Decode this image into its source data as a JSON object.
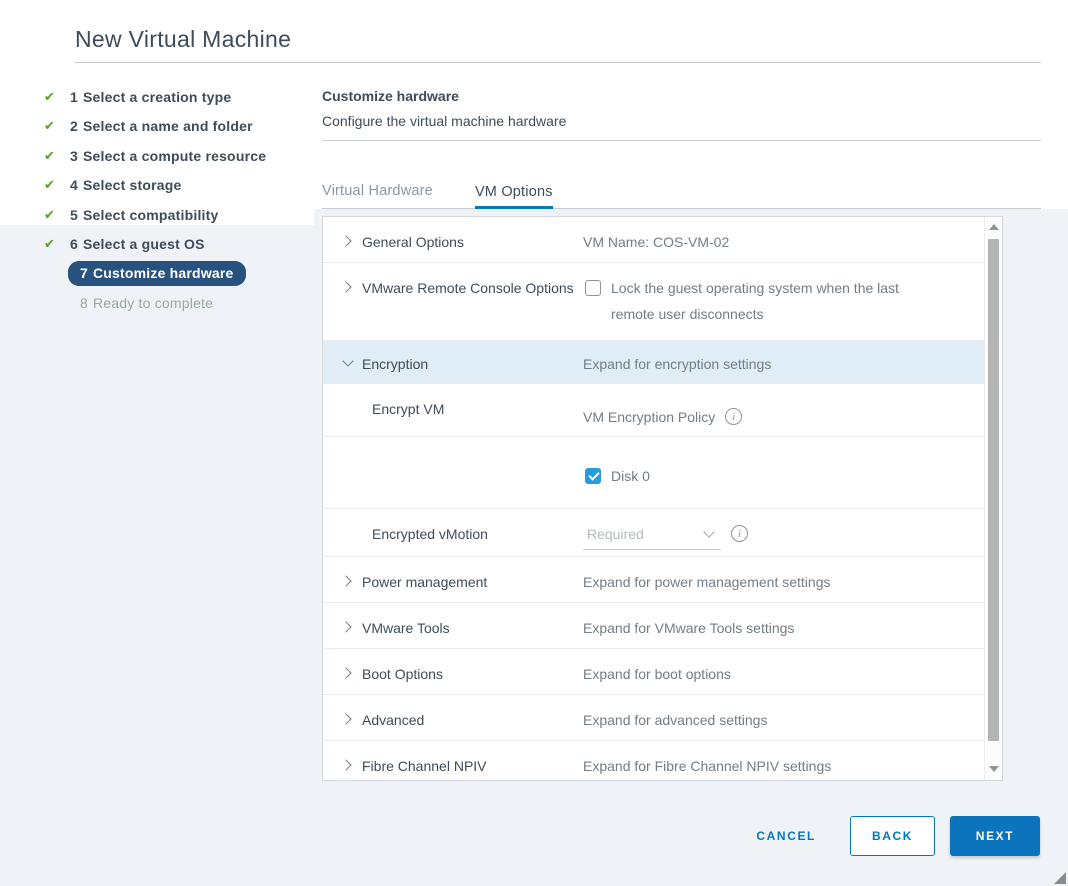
{
  "colors": {
    "accent_blue": "#0079b8",
    "next_button_blue": "#0b74bd",
    "checkbox_blue": "#279bdb",
    "step_badge_navy": "#28527d",
    "check_green": "#55a121",
    "row_highlight": "#e0ecf6",
    "page_tint": "#eff3f8"
  },
  "window": {
    "title": "New Virtual Machine"
  },
  "steps": [
    {
      "num": "1",
      "label": "Select a creation type",
      "state": "done"
    },
    {
      "num": "2",
      "label": "Select a name and folder",
      "state": "done"
    },
    {
      "num": "3",
      "label": "Select a compute resource",
      "state": "done"
    },
    {
      "num": "4",
      "label": "Select storage",
      "state": "done"
    },
    {
      "num": "5",
      "label": "Select compatibility",
      "state": "done"
    },
    {
      "num": "6",
      "label": "Select a guest OS",
      "state": "done"
    },
    {
      "num": "7",
      "label": "Customize hardware",
      "state": "current"
    },
    {
      "num": "8",
      "label": "Ready to complete",
      "state": "upcoming"
    }
  ],
  "pane": {
    "title": "Customize hardware",
    "subtitle": "Configure the virtual machine hardware"
  },
  "tabs": [
    {
      "label": "Virtual Hardware",
      "active": false
    },
    {
      "label": "VM Options",
      "active": true
    }
  ],
  "options_table": {
    "rows": [
      {
        "id": "general-options",
        "chevron": "collapsed",
        "label": "General Options",
        "right": {
          "type": "text",
          "text": "VM Name: COS-VM-02"
        }
      },
      {
        "id": "vmrc-options",
        "chevron": "collapsed",
        "label": "VMware Remote Console Options",
        "right": {
          "type": "checkbox",
          "checked": false,
          "text": "Lock the guest operating system when the last remote user disconnects"
        }
      },
      {
        "id": "encryption",
        "chevron": "expanded",
        "label": "Encryption",
        "highlighted": true,
        "right": {
          "type": "text",
          "text": "Expand for encryption settings"
        }
      },
      {
        "id": "encrypt-vm",
        "chevron": null,
        "indent": true,
        "label": "Encrypt VM",
        "right": {
          "type": "text-info",
          "text": "VM Encryption Policy"
        }
      },
      {
        "id": "disk-0",
        "chevron": null,
        "label": "",
        "right": {
          "type": "checkbox",
          "checked": true,
          "text": "Disk 0"
        }
      },
      {
        "id": "encrypted-vmotion",
        "chevron": null,
        "indent": true,
        "label": "Encrypted vMotion",
        "right": {
          "type": "select",
          "value": "Required",
          "disabled": true,
          "info": true
        }
      },
      {
        "id": "power-management",
        "chevron": "collapsed",
        "label": "Power management",
        "right": {
          "type": "text",
          "text": "Expand for power management settings"
        }
      },
      {
        "id": "vmware-tools",
        "chevron": "collapsed",
        "label": "VMware Tools",
        "right": {
          "type": "text",
          "text": "Expand for VMware Tools settings"
        }
      },
      {
        "id": "boot-options",
        "chevron": "collapsed",
        "label": "Boot Options",
        "right": {
          "type": "text",
          "text": "Expand for boot options"
        }
      },
      {
        "id": "advanced",
        "chevron": "collapsed",
        "label": "Advanced",
        "right": {
          "type": "text",
          "text": "Expand for advanced settings"
        }
      },
      {
        "id": "fibre-channel-npiv",
        "chevron": "collapsed",
        "label": "Fibre Channel NPIV",
        "right": {
          "type": "text",
          "text": "Expand for Fibre Channel NPIV settings"
        }
      }
    ]
  },
  "footer": {
    "cancel_label": "CANCEL",
    "back_label": "BACK",
    "next_label": "NEXT"
  },
  "icons": {
    "checkmark_glyph": "✔",
    "step_done": "checkmark-icon",
    "row_collapsed": "chevron-right-icon",
    "row_expanded": "chevron-down-icon",
    "help": "info-icon",
    "scroll_up": "triangle-up-icon",
    "scroll_down": "triangle-down-icon",
    "window_resize": "resize-handle-icon"
  }
}
